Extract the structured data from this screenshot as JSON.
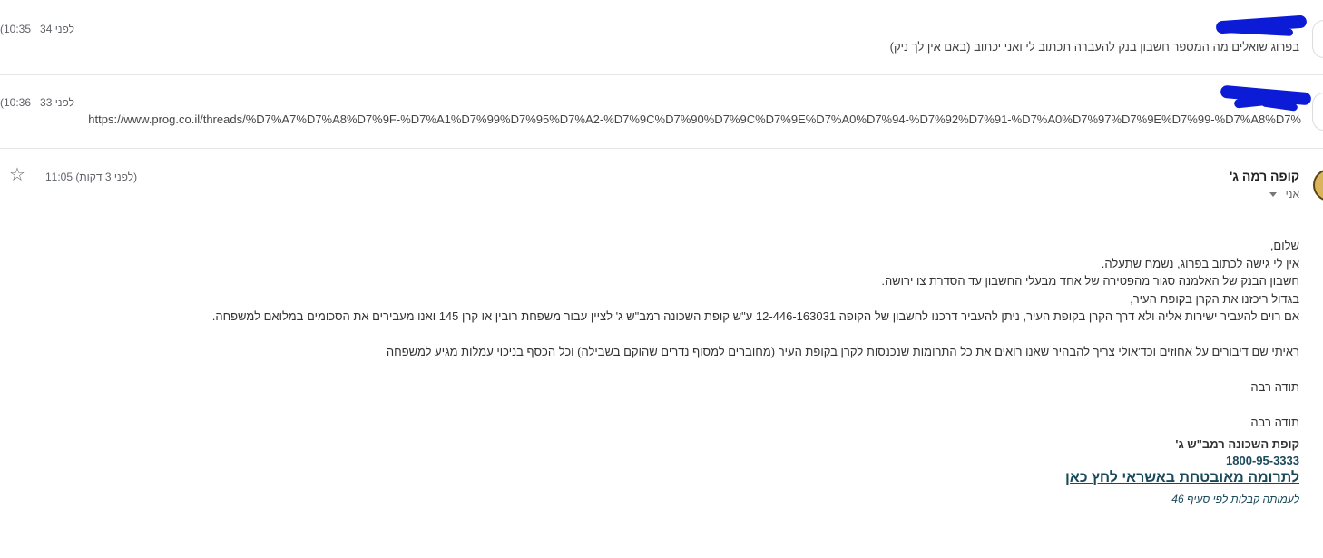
{
  "thread": {
    "messages": [
      {
        "time": "10:35",
        "relative": "(לפני 34",
        "snippet": "בפרוג שואלים מה המספר חשבון בנק להעברה תכתוב לי ואני יכתוב (באם אין לך ניק)"
      },
      {
        "time": "10:36",
        "relative": "(לפני 33",
        "snippet": "https://www.prog.co.il/threads/%D7%A7%D7%A8%D7%9F-%D7%A1%D7%99%D7%95%D7%A2-%D7%9C%D7%90%D7%9C%D7%9E%D7%A0%D7%94-%D7%92%D7%91-%D7%A0%D7%97%D7%9E%D7%99-%D7%A8%D7%"
      }
    ],
    "open_message": {
      "sender": "קופה רמה ג'",
      "recipient": "אני",
      "time": "11:05 (לפני 3 דקות)",
      "body": [
        "שלום,",
        "אין לי גישה לכתוב בפרוג, נשמח שתעלה.",
        "חשבון הבנק של האלמנה סגור מהפטירה של אחד מבעלי החשבון עד הסדרת צו ירושה.",
        "בגדול ריכזנו את הקרן בקופת העיר,",
        "אם רוים להעביר ישירות אליה ולא דרך הקרן בקופת העיר, ניתן להעביר דרכנו לחשבון של הקופה  12-446-163031 ע\"ש קופת השכונה רמב\"ש ג' לציין עבור משפחת רובין או קרן 145 ואנו מעבירים את הסכומים במלואם למשפחה.",
        "",
        "ראיתי שם דיבורים על אחוזים וכד'אולי צריך להבהיר שאנו רואים את כל התרומות שנכנסות לקרן בקופת העיר (מחוברים למסוף נדרים שהוקם בשבילה) וכל הכסף בניכוי עמלות מגיע למשפחה",
        "",
        "תודה רבה",
        "",
        "תודה רבה"
      ],
      "signature": {
        "org": "קופת השכונה רמב\"ש ג'",
        "phone": "1800-95-3333",
        "donate_link": "לתרומה מאובטחת באשראי לחץ כאן",
        "note": "לעמותה קבלות לפי סעיף 46"
      }
    }
  },
  "icons": {
    "star": "star-icon",
    "dropdown": "chevron-down-icon"
  },
  "colors": {
    "link": "#1a4a5a",
    "redaction": "#0b1bd6",
    "divider": "#e6e6e6",
    "muted": "#5f6368"
  }
}
